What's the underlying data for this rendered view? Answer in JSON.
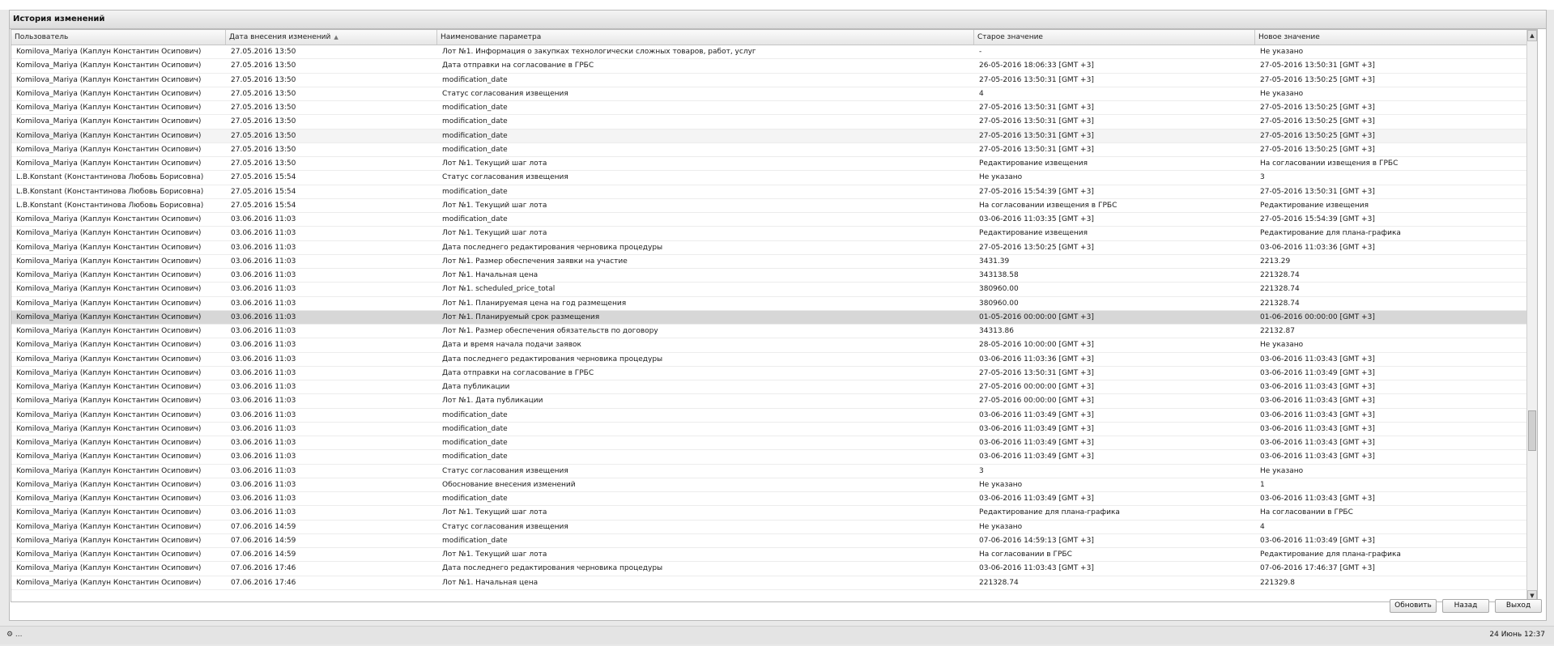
{
  "window": {
    "title": "История изменений"
  },
  "columns": [
    "Пользователь",
    "Дата внесения изменений",
    "Наименование параметра",
    "Старое значение",
    "Новое значение"
  ],
  "rows": [
    [
      "Komilova_Mariya (Каплун Константин Осипович)",
      "27.05.2016 13:50",
      "Лот №1. Информация о закупках технологически сложных товаров, работ, услуг",
      "-",
      "Не указано"
    ],
    [
      "Komilova_Mariya (Каплун Константин Осипович)",
      "27.05.2016 13:50",
      "Дата отправки на согласование в ГРБС",
      "26-05-2016 18:06:33 [GMT +3]",
      "27-05-2016 13:50:31 [GMT +3]"
    ],
    [
      "Komilova_Mariya (Каплун Константин Осипович)",
      "27.05.2016 13:50",
      "modification_date",
      "27-05-2016 13:50:31 [GMT +3]",
      "27-05-2016 13:50:25 [GMT +3]"
    ],
    [
      "Komilova_Mariya (Каплун Константин Осипович)",
      "27.05.2016 13:50",
      "Статус согласования извещения",
      "4",
      "Не указано"
    ],
    [
      "Komilova_Mariya (Каплун Константин Осипович)",
      "27.05.2016 13:50",
      "modification_date",
      "27-05-2016 13:50:31 [GMT +3]",
      "27-05-2016 13:50:25 [GMT +3]"
    ],
    [
      "Komilova_Mariya (Каплун Константин Осипович)",
      "27.05.2016 13:50",
      "modification_date",
      "27-05-2016 13:50:31 [GMT +3]",
      "27-05-2016 13:50:25 [GMT +3]"
    ],
    [
      "Komilova_Mariya (Каплун Константин Осипович)",
      "27.05.2016 13:50",
      "modification_date",
      "27-05-2016 13:50:31 [GMT +3]",
      "27-05-2016 13:50:25 [GMT +3]"
    ],
    [
      "Komilova_Mariya (Каплун Константин Осипович)",
      "27.05.2016 13:50",
      "modification_date",
      "27-05-2016 13:50:31 [GMT +3]",
      "27-05-2016 13:50:25 [GMT +3]"
    ],
    [
      "Komilova_Mariya (Каплун Константин Осипович)",
      "27.05.2016 13:50",
      "Лот №1. Текущий шаг лота",
      "Редактирование извещения",
      "На согласовании извещения в ГРБС"
    ],
    [
      "L.B.Konstant (Константинова Любовь Борисовна)",
      "27.05.2016 15:54",
      "Статус согласования извещения",
      "Не указано",
      "3"
    ],
    [
      "L.B.Konstant (Константинова Любовь Борисовна)",
      "27.05.2016 15:54",
      "modification_date",
      "27-05-2016 15:54:39 [GMT +3]",
      "27-05-2016 13:50:31 [GMT +3]"
    ],
    [
      "L.B.Konstant (Константинова Любовь Борисовна)",
      "27.05.2016 15:54",
      "Лот №1. Текущий шаг лота",
      "На согласовании извещения в ГРБС",
      "Редактирование извещения"
    ],
    [
      "Komilova_Mariya (Каплун Константин Осипович)",
      "03.06.2016 11:03",
      "modification_date",
      "03-06-2016 11:03:35 [GMT +3]",
      "27-05-2016 15:54:39 [GMT +3]"
    ],
    [
      "Komilova_Mariya (Каплун Константин Осипович)",
      "03.06.2016 11:03",
      "Лот №1. Текущий шаг лота",
      "Редактирование извещения",
      "Редактирование для плана-графика"
    ],
    [
      "Komilova_Mariya (Каплун Константин Осипович)",
      "03.06.2016 11:03",
      "Дата последнего редактирования черновика процедуры",
      "27-05-2016 13:50:25 [GMT +3]",
      "03-06-2016 11:03:36 [GMT +3]"
    ],
    [
      "Komilova_Mariya (Каплун Константин Осипович)",
      "03.06.2016 11:03",
      "Лот №1. Размер обеспечения заявки на участие",
      "3431.39",
      "2213.29"
    ],
    [
      "Komilova_Mariya (Каплун Константин Осипович)",
      "03.06.2016 11:03",
      "Лот №1. Начальная цена",
      "343138.58",
      "221328.74"
    ],
    [
      "Komilova_Mariya (Каплун Константин Осипович)",
      "03.06.2016 11:03",
      "Лот №1. scheduled_price_total",
      "380960.00",
      "221328.74"
    ],
    [
      "Komilova_Mariya (Каплун Константин Осипович)",
      "03.06.2016 11:03",
      "Лот №1. Планируемая цена на год размещения",
      "380960.00",
      "221328.74"
    ],
    [
      "Komilova_Mariya (Каплун Константин Осипович)",
      "03.06.2016 11:03",
      "Лот №1. Планируемый срок размещения",
      "01-05-2016 00:00:00 [GMT +3]",
      "01-06-2016 00:00:00 [GMT +3]"
    ],
    [
      "Komilova_Mariya (Каплун Константин Осипович)",
      "03.06.2016 11:03",
      "Лот №1. Размер обеспечения обязательств по договору",
      "34313.86",
      "22132.87"
    ],
    [
      "Komilova_Mariya (Каплун Константин Осипович)",
      "03.06.2016 11:03",
      "Дата и время начала подачи заявок",
      "28-05-2016 10:00:00 [GMT +3]",
      "Не указано"
    ],
    [
      "Komilova_Mariya (Каплун Константин Осипович)",
      "03.06.2016 11:03",
      "Дата последнего редактирования черновика процедуры",
      "03-06-2016 11:03:36 [GMT +3]",
      "03-06-2016 11:03:43 [GMT +3]"
    ],
    [
      "Komilova_Mariya (Каплун Константин Осипович)",
      "03.06.2016 11:03",
      "Дата отправки на согласование в ГРБС",
      "27-05-2016 13:50:31 [GMT +3]",
      "03-06-2016 11:03:49 [GMT +3]"
    ],
    [
      "Komilova_Mariya (Каплун Константин Осипович)",
      "03.06.2016 11:03",
      "Дата публикации",
      "27-05-2016 00:00:00 [GMT +3]",
      "03-06-2016 11:03:43 [GMT +3]"
    ],
    [
      "Komilova_Mariya (Каплун Константин Осипович)",
      "03.06.2016 11:03",
      "Лот №1. Дата публикации",
      "27-05-2016 00:00:00 [GMT +3]",
      "03-06-2016 11:03:43 [GMT +3]"
    ],
    [
      "Komilova_Mariya (Каплун Константин Осипович)",
      "03.06.2016 11:03",
      "modification_date",
      "03-06-2016 11:03:49 [GMT +3]",
      "03-06-2016 11:03:43 [GMT +3]"
    ],
    [
      "Komilova_Mariya (Каплун Константин Осипович)",
      "03.06.2016 11:03",
      "modification_date",
      "03-06-2016 11:03:49 [GMT +3]",
      "03-06-2016 11:03:43 [GMT +3]"
    ],
    [
      "Komilova_Mariya (Каплун Константин Осипович)",
      "03.06.2016 11:03",
      "modification_date",
      "03-06-2016 11:03:49 [GMT +3]",
      "03-06-2016 11:03:43 [GMT +3]"
    ],
    [
      "Komilova_Mariya (Каплун Константин Осипович)",
      "03.06.2016 11:03",
      "modification_date",
      "03-06-2016 11:03:49 [GMT +3]",
      "03-06-2016 11:03:43 [GMT +3]"
    ],
    [
      "Komilova_Mariya (Каплун Константин Осипович)",
      "03.06.2016 11:03",
      "Статус согласования извещения",
      "3",
      "Не указано"
    ],
    [
      "Komilova_Mariya (Каплун Константин Осипович)",
      "03.06.2016 11:03",
      "Обоснование внесения изменений",
      "Не указано",
      "1"
    ],
    [
      "Komilova_Mariya (Каплун Константин Осипович)",
      "03.06.2016 11:03",
      "modification_date",
      "03-06-2016 11:03:49 [GMT +3]",
      "03-06-2016 11:03:43 [GMT +3]"
    ],
    [
      "Komilova_Mariya (Каплун Константин Осипович)",
      "03.06.2016 11:03",
      "Лот №1. Текущий шаг лота",
      "Редактирование для плана-графика",
      "На согласовании в ГРБС"
    ],
    [
      "Komilova_Mariya (Каплун Константин Осипович)",
      "07.06.2016 14:59",
      "Статус согласования извещения",
      "Не указано",
      "4"
    ],
    [
      "Komilova_Mariya (Каплун Константин Осипович)",
      "07.06.2016 14:59",
      "modification_date",
      "07-06-2016 14:59:13 [GMT +3]",
      "03-06-2016 11:03:49 [GMT +3]"
    ],
    [
      "Komilova_Mariya (Каплун Константин Осипович)",
      "07.06.2016 14:59",
      "Лот №1. Текущий шаг лота",
      "На согласовании в ГРБС",
      "Редактирование для плана-графика"
    ],
    [
      "Komilova_Mariya (Каплун Константин Осипович)",
      "07.06.2016 17:46",
      "Дата последнего редактирования черновика процедуры",
      "03-06-2016 11:03:43 [GMT +3]",
      "07-06-2016 17:46:37 [GMT +3]"
    ],
    [
      "Komilova_Mariya (Каплун Константин Осипович)",
      "07.06.2016 17:46",
      "Лот №1. Начальная цена",
      "221328.74",
      "221329.8"
    ]
  ],
  "selected_row_index": 19,
  "hover_row_index": 6,
  "sort": {
    "column": "Дата внесения изменений",
    "direction": "asc",
    "indicator": "▲"
  },
  "buttons": {
    "refresh": "Обновить",
    "back": "Назад",
    "exit": "Выход"
  },
  "scrollbar": {
    "up": "▲",
    "down": "▼"
  },
  "status_bar": {
    "left_text": "⚙ ...",
    "right_text": "24 Июнь 12:37"
  },
  "colors": {
    "selected_row": "#d7d7d7",
    "hover_row": "#f4f4f4",
    "panel_bg": "#ffffff"
  }
}
